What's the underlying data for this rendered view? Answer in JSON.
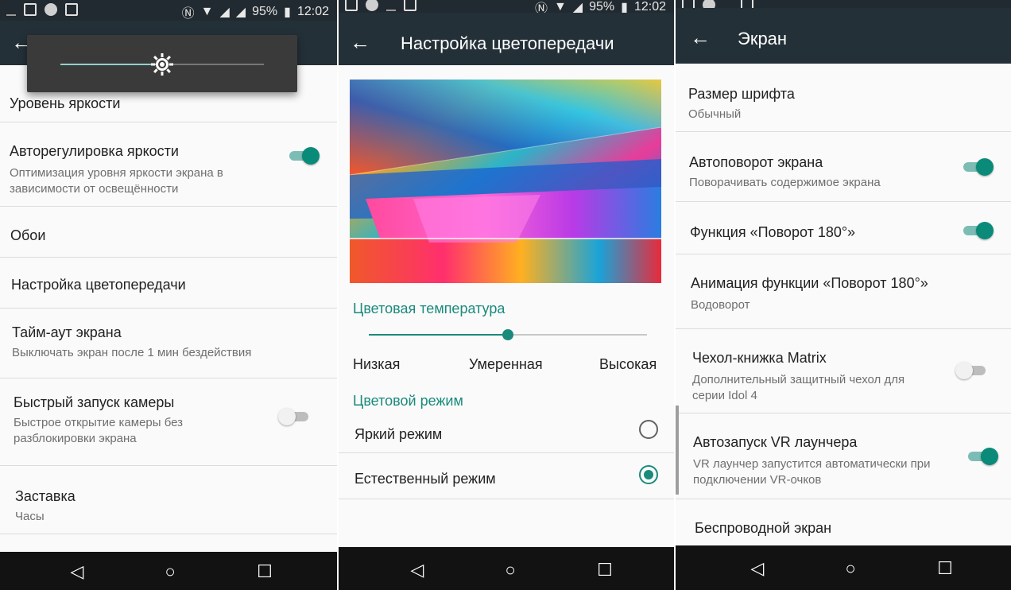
{
  "status": {
    "battery": "95%",
    "time": "12:02"
  },
  "screen1": {
    "items": [
      {
        "title": "Уровень яркости"
      },
      {
        "title": "Авторегулировка яркости",
        "subtitle": "Оптимизация уровня яркости экрана в зависимости от освещённости",
        "toggle": "on"
      },
      {
        "title": "Обои"
      },
      {
        "title": "Настройка цветопередачи"
      },
      {
        "title": "Тайм-аут экрана",
        "subtitle": "Выключать экран после 1 мин бездействия"
      },
      {
        "title": "Быстрый запуск камеры",
        "subtitle": "Быстрое открытие камеры без разблокировки экрана",
        "toggle": "off"
      },
      {
        "title": "Заставка",
        "subtitle": "Часы"
      }
    ],
    "brightness_level": 0.5
  },
  "screen2": {
    "title": "Настройка цветопередачи",
    "color_temperature_heading": "Цветовая температура",
    "temperature_level": 0.5,
    "temp_labels": [
      "Низкая",
      "Умеренная",
      "Высокая"
    ],
    "color_mode_heading": "Цветовой режим",
    "modes": [
      {
        "label": "Яркий режим",
        "checked": false
      },
      {
        "label": "Естественный режим",
        "checked": true
      }
    ]
  },
  "screen3": {
    "title": "Экран",
    "items": [
      {
        "title": "Размер шрифта",
        "subtitle": "Обычный"
      },
      {
        "title": "Автоповорот экрана",
        "subtitle": "Поворачивать содержимое экрана",
        "toggle": "on"
      },
      {
        "title": "Функция «Поворот 180°»",
        "toggle": "on"
      },
      {
        "title": "Анимация функции «Поворот 180°»",
        "subtitle": "Водоворот"
      },
      {
        "title": "Чехол-книжка Matrix",
        "subtitle": "Дополнительный защитный чехол для серии Idol 4",
        "toggle": "off"
      },
      {
        "title": "Автозапуск VR лаунчера",
        "subtitle": "VR лаунчер запустится автоматически при подключении VR-очков",
        "toggle": "on"
      },
      {
        "title": "Беспроводной экран"
      }
    ]
  },
  "colors": {
    "accent": "#1a8a7c",
    "appbar": "#243038",
    "navbar": "#121212"
  },
  "icons": {
    "back": "arrow-left",
    "nav_back": "triangle-back",
    "nav_home": "circle-home",
    "nav_recent": "square-recent",
    "brightness": "sun"
  }
}
